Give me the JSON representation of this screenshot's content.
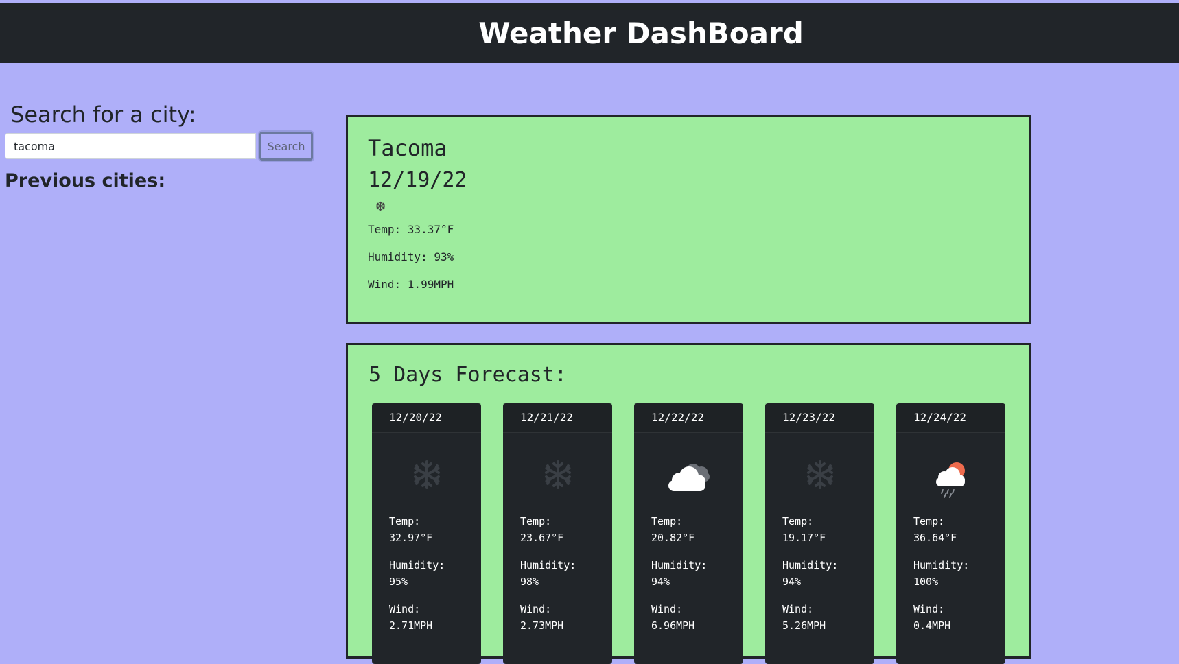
{
  "header": {
    "title": "Weather DashBoard"
  },
  "search": {
    "heading": "Search for a city:",
    "value": "tacoma",
    "button_label": "Search"
  },
  "previous": {
    "heading": "Previous cities:"
  },
  "current": {
    "city": "Tacoma",
    "date": "12/19/22",
    "icon": "snowflake-icon",
    "temp": "Temp: 33.37°F",
    "humidity": "Humidity: 93%",
    "wind": "Wind: 1.99MPH"
  },
  "forecast": {
    "title": "5 Days Forecast:",
    "temp_label": "Temp:",
    "humidity_label": "Humidity:",
    "wind_label": "Wind:",
    "days": [
      {
        "date": "12/20/22",
        "icon": "snowflake-icon",
        "temp": "32.97°F",
        "humidity": "95%",
        "wind": "2.71MPH"
      },
      {
        "date": "12/21/22",
        "icon": "snowflake-icon",
        "temp": "23.67°F",
        "humidity": "98%",
        "wind": "2.73MPH"
      },
      {
        "date": "12/22/22",
        "icon": "clouds-icon",
        "temp": "20.82°F",
        "humidity": "94%",
        "wind": "6.96MPH"
      },
      {
        "date": "12/23/22",
        "icon": "snowflake-icon",
        "temp": "19.17°F",
        "humidity": "94%",
        "wind": "5.26MPH"
      },
      {
        "date": "12/24/22",
        "icon": "sun-rain-cloud-icon",
        "temp": "36.64°F",
        "humidity": "100%",
        "wind": "0.4MPH"
      }
    ]
  }
}
